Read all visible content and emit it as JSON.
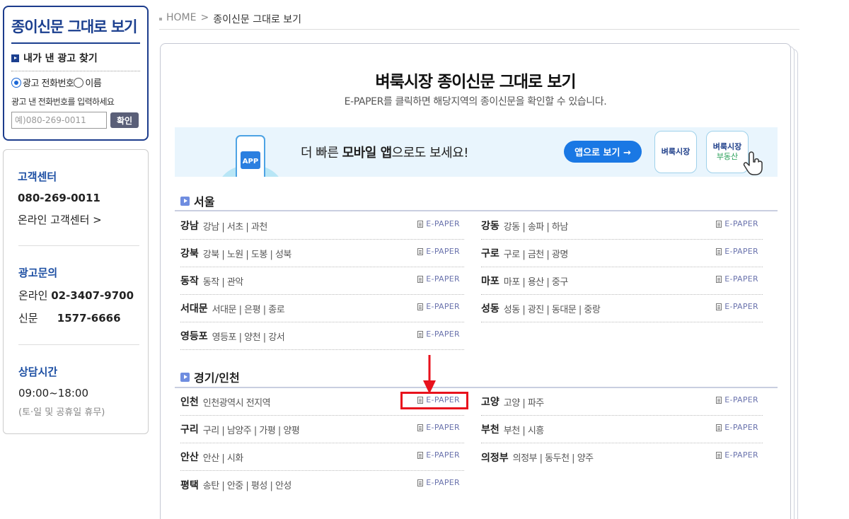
{
  "search": {
    "title": "종이신문 그대로 보기",
    "subtitle": "내가 낸 광고 찾기",
    "radio_phone": "광고 전화번호",
    "radio_name": "이름",
    "hint": "광고 낸 전화번호를 입력하세요",
    "placeholder": "예)080-269-0011",
    "confirm": "확인"
  },
  "customer_center": {
    "title": "고객센터",
    "phone": "080-269-0011",
    "online_link": "온라인 고객센터 >",
    "ad_title": "광고문의",
    "online_label": "온라인",
    "online_phone": "02-3407-9700",
    "paper_label": "신문",
    "paper_phone": "1577-6666",
    "hours_title": "상담시간",
    "hours": "09:00~18:00",
    "hours_note": "(토·일 및 공휴일 휴무)"
  },
  "breadcrumb": {
    "home": "HOME",
    "separator": ">",
    "current": "종이신문 그대로 보기"
  },
  "main": {
    "title": "벼룩시장 종이신문 그대로 보기",
    "subtitle": "E-PAPER를 클릭하면 해당지역의 종이신문을 확인할 수 있습니다."
  },
  "banner": {
    "app_badge": "APP",
    "text_before": "더 빠른 ",
    "text_bold": "모바일 앱",
    "text_after": "으로도 보세요!",
    "button": "앱으로 보기 →",
    "card1": "벼룩시장",
    "card2_top": "벼룩시장",
    "card2_bottom": "부동산"
  },
  "epaper_label": "E-PAPER",
  "seoul": {
    "title": "서울",
    "left": [
      {
        "name": "강남",
        "areas": "강남 | 서초 | 과천"
      },
      {
        "name": "강북",
        "areas": "강북 | 노원 | 도봉 | 성북"
      },
      {
        "name": "동작",
        "areas": "동작 | 관악"
      },
      {
        "name": "서대문",
        "areas": "서대문 | 은평 | 종로"
      },
      {
        "name": "영등포",
        "areas": "영등포 | 양천 | 강서"
      }
    ],
    "right": [
      {
        "name": "강동",
        "areas": "강동 | 송파 | 하남"
      },
      {
        "name": "구로",
        "areas": "구로 | 금천 | 광명"
      },
      {
        "name": "마포",
        "areas": "마포 | 용산 | 중구"
      },
      {
        "name": "성동",
        "areas": "성동 | 광진 | 동대문 | 중랑"
      }
    ]
  },
  "gyeonggi": {
    "title": "경기/인천",
    "left": [
      {
        "name": "인천",
        "areas": "인천광역시 전지역"
      },
      {
        "name": "구리",
        "areas": "구리 | 남양주 | 가평 | 양평"
      },
      {
        "name": "안산",
        "areas": "안산 | 시화"
      },
      {
        "name": "평택",
        "areas": "송탄 | 안중 | 평성 | 안성"
      }
    ],
    "right": [
      {
        "name": "고양",
        "areas": "고양 | 파주"
      },
      {
        "name": "부천",
        "areas": "부천 | 시흥"
      },
      {
        "name": "의정부",
        "areas": "의정부 | 동두천 | 양주"
      }
    ]
  },
  "colors": {
    "brand_navy": "#1b3f8f",
    "accent_blue": "#1a78e4",
    "highlight_red": "#e8121d",
    "epaper_text": "#6a73ad"
  }
}
